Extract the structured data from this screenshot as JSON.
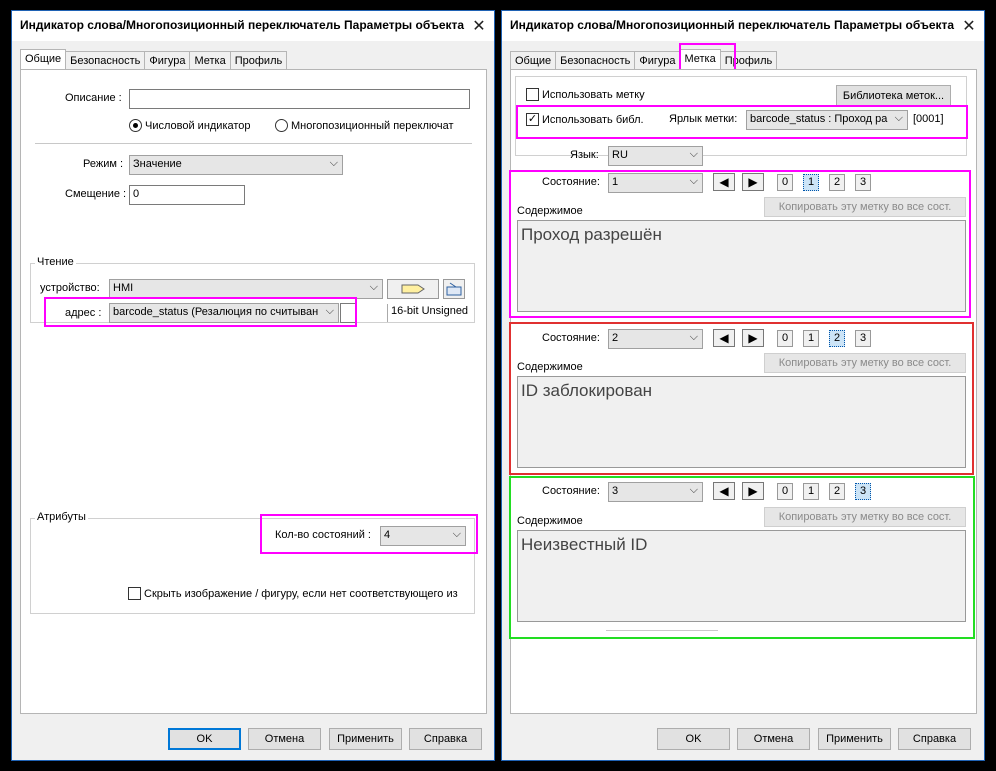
{
  "left": {
    "title": "Индикатор слова/Многопозиционный переключатель Параметры объекта",
    "tabs": [
      "Общие",
      "Безопасность",
      "Фигура",
      "Метка",
      "Профиль"
    ],
    "description_label": "Описание :",
    "description_value": "",
    "radio_numeric": "Числовой индикатор",
    "radio_multistate": "Многопозиционный переключат",
    "mode_label": "Режим :",
    "mode_value": "Значение",
    "offset_label": "Смещение :",
    "offset_value": "0",
    "read_group": "Чтение",
    "device_label": "устройство:",
    "device_value": "HMI",
    "address_label": "адрес :",
    "address_value": "barcode_status (Резалюция по считыван",
    "data_type": "16-bit Unsigned",
    "attributes_group": "Атрибуты",
    "num_states_label": "Кол-во состояний :",
    "num_states_value": "4",
    "hide_image_label": "Скрыть изображение / фигуру, если нет соответствующего из",
    "buttons": {
      "ok": "OK",
      "cancel": "Отмена",
      "apply": "Применить",
      "help": "Справка"
    }
  },
  "right": {
    "title": "Индикатор слова/Многопозиционный переключатель Параметры объекта",
    "tabs": [
      "Общие",
      "Безопасность",
      "Фигура",
      "Метка",
      "Профиль"
    ],
    "use_label": "Использовать метку",
    "use_label_checked": false,
    "label_library_button": "Библиотека меток...",
    "use_library": "Использовать библ.",
    "use_library_checked": true,
    "label_tag_label": "Ярлык метки:",
    "label_tag_value": "barcode_status : Проход ра",
    "label_tag_code": "[0001]",
    "language_label": "Язык:",
    "language_value": "RU",
    "copy_button": "Копировать эту метку во все сост.",
    "state_label": "Состояние:",
    "content_label": "Содержимое",
    "state_numbers": [
      "0",
      "1",
      "2",
      "3"
    ],
    "states": [
      {
        "value": "1",
        "selected_index": 1,
        "content": "Проход разрешён"
      },
      {
        "value": "2",
        "selected_index": 2,
        "content": "ID заблокирован"
      },
      {
        "value": "3",
        "selected_index": 3,
        "content": "Неизвестный ID"
      }
    ],
    "buttons": {
      "ok": "OK",
      "cancel": "Отмена",
      "apply": "Применить",
      "help": "Справка"
    }
  },
  "colors": {
    "highlight_magenta": "#ff00ff",
    "highlight_red": "#e03030",
    "highlight_green": "#22dd22",
    "accent": "#0078d7"
  }
}
